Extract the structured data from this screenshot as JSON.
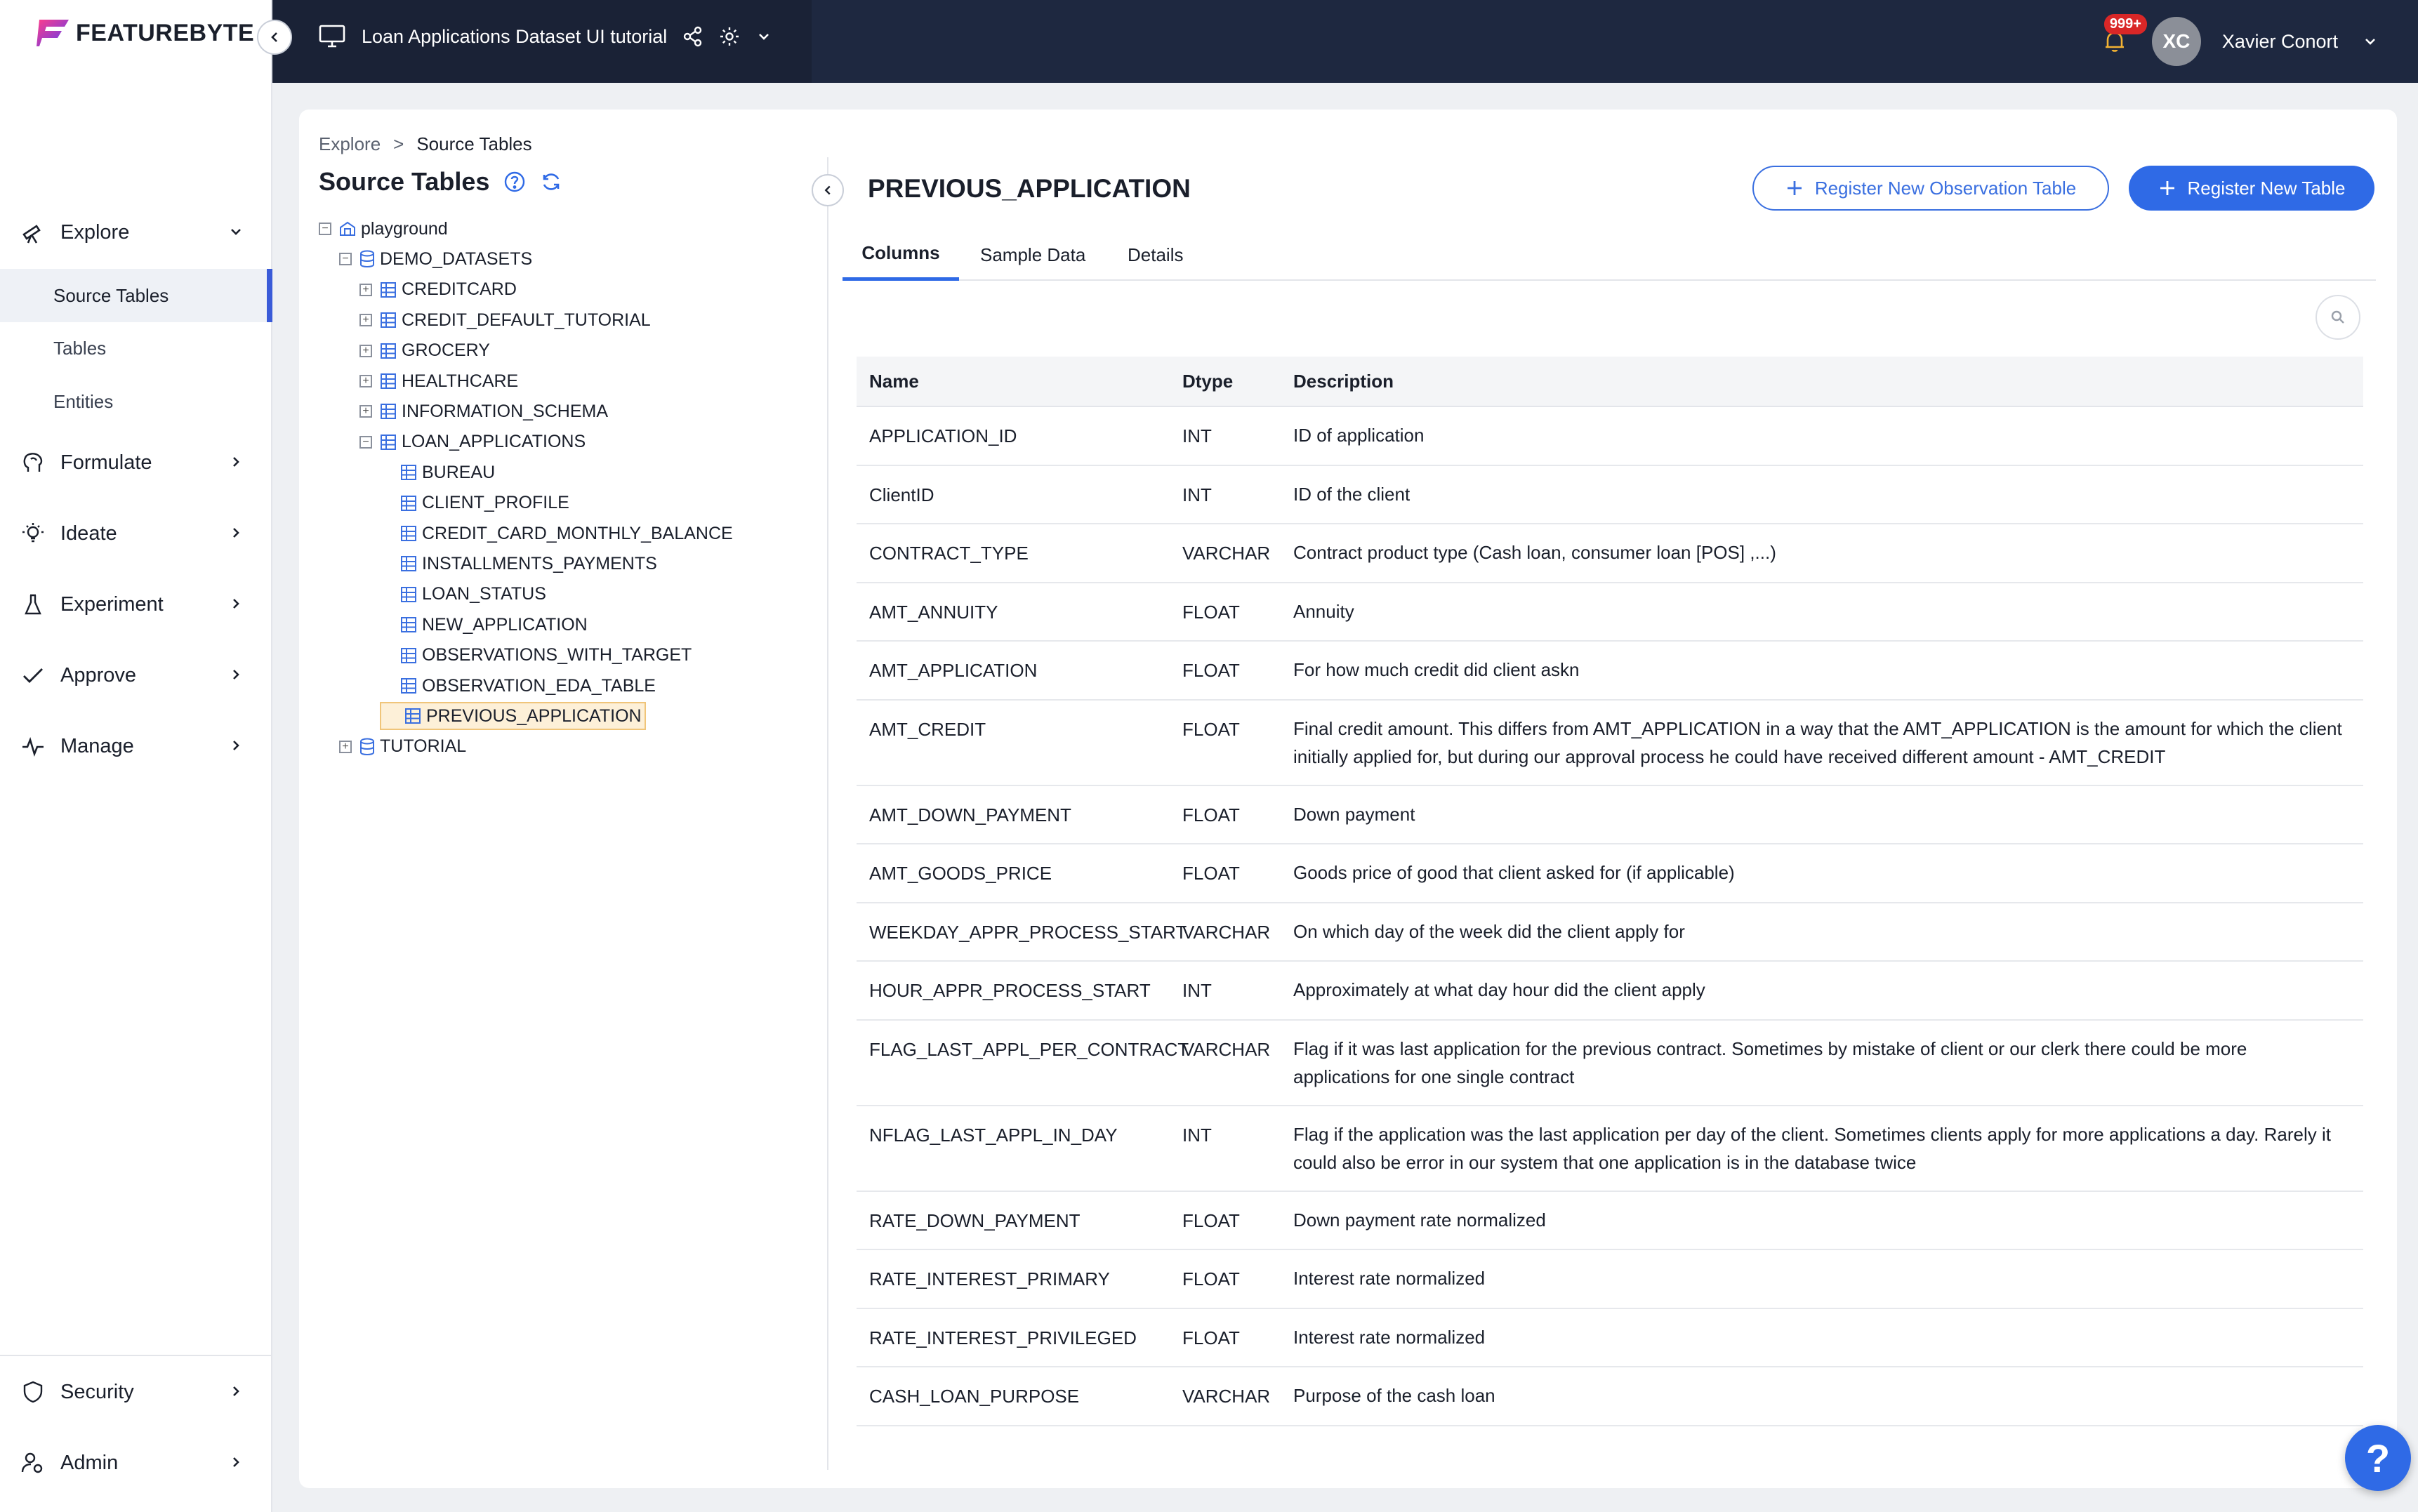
{
  "app": {
    "brand": "FEATUREBYTE",
    "accent": "#2f6ae6"
  },
  "sidebar": {
    "items": [
      {
        "label": "Explore",
        "icon": "telescope-icon"
      },
      {
        "label": "Formulate",
        "icon": "brain-icon"
      },
      {
        "label": "Ideate",
        "icon": "lightbulb-icon"
      },
      {
        "label": "Experiment",
        "icon": "flask-icon"
      },
      {
        "label": "Approve",
        "icon": "check-icon"
      },
      {
        "label": "Manage",
        "icon": "pulse-icon"
      }
    ],
    "explore_sub": [
      "Source Tables",
      "Tables",
      "Entities"
    ],
    "bottom": [
      {
        "label": "Security",
        "icon": "shield-icon"
      },
      {
        "label": "Admin",
        "icon": "user-gear-icon"
      }
    ]
  },
  "topbar": {
    "workspace": "Loan Applications Dataset UI tutorial",
    "notifications": "999+",
    "avatar_initials": "XC",
    "user_name": "Xavier Conort"
  },
  "breadcrumb": {
    "root": "Explore",
    "sep": ">",
    "current": "Source Tables"
  },
  "source_tables_title": "Source Tables",
  "tree": [
    {
      "label": "playground",
      "level": 0,
      "type": "catalog",
      "toggle": "−"
    },
    {
      "label": "DEMO_DATASETS",
      "level": 1,
      "type": "schema",
      "toggle": "−"
    },
    {
      "label": "CREDITCARD",
      "level": 2,
      "type": "schema-table",
      "toggle": "+"
    },
    {
      "label": "CREDIT_DEFAULT_TUTORIAL",
      "level": 2,
      "type": "schema-table",
      "toggle": "+"
    },
    {
      "label": "GROCERY",
      "level": 2,
      "type": "schema-table",
      "toggle": "+"
    },
    {
      "label": "HEALTHCARE",
      "level": 2,
      "type": "schema-table",
      "toggle": "+"
    },
    {
      "label": "INFORMATION_SCHEMA",
      "level": 2,
      "type": "schema-table",
      "toggle": "+"
    },
    {
      "label": "LOAN_APPLICATIONS",
      "level": 2,
      "type": "schema-table",
      "toggle": "−"
    },
    {
      "label": "BUREAU",
      "level": 3,
      "type": "table"
    },
    {
      "label": "CLIENT_PROFILE",
      "level": 3,
      "type": "table"
    },
    {
      "label": "CREDIT_CARD_MONTHLY_BALANCE",
      "level": 3,
      "type": "table"
    },
    {
      "label": "INSTALLMENTS_PAYMENTS",
      "level": 3,
      "type": "table"
    },
    {
      "label": "LOAN_STATUS",
      "level": 3,
      "type": "table"
    },
    {
      "label": "NEW_APPLICATION",
      "level": 3,
      "type": "table"
    },
    {
      "label": "OBSERVATIONS_WITH_TARGET",
      "level": 3,
      "type": "table"
    },
    {
      "label": "OBSERVATION_EDA_TABLE",
      "level": 3,
      "type": "table"
    },
    {
      "label": "PREVIOUS_APPLICATION",
      "level": 3,
      "type": "table",
      "selected": true
    },
    {
      "label": "TUTORIAL",
      "level": 1,
      "type": "schema",
      "toggle": "+"
    }
  ],
  "main": {
    "title": "PREVIOUS_APPLICATION",
    "btn_obs": "Register New Observation Table",
    "btn_table": "Register New Table",
    "tabs": [
      "Columns",
      "Sample Data",
      "Details"
    ],
    "columns": {
      "name": "Name",
      "dtype": "Dtype",
      "description": "Description"
    },
    "rows": [
      {
        "name": "APPLICATION_ID",
        "dtype": "INT",
        "desc": "ID of application"
      },
      {
        "name": "ClientID",
        "dtype": "INT",
        "desc": "ID of the client"
      },
      {
        "name": "CONTRACT_TYPE",
        "dtype": "VARCHAR",
        "desc": "Contract product type (Cash loan, consumer loan [POS] ,...)"
      },
      {
        "name": "AMT_ANNUITY",
        "dtype": "FLOAT",
        "desc": "Annuity"
      },
      {
        "name": "AMT_APPLICATION",
        "dtype": "FLOAT",
        "desc": "For how much credit did client askn"
      },
      {
        "name": "AMT_CREDIT",
        "dtype": "FLOAT",
        "desc": "Final credit amount. This differs from AMT_APPLICATION in a way that the AMT_APPLICATION is the amount for which the client initially applied for, but during our approval process he could have received different amount - AMT_CREDIT"
      },
      {
        "name": "AMT_DOWN_PAYMENT",
        "dtype": "FLOAT",
        "desc": "Down payment"
      },
      {
        "name": "AMT_GOODS_PRICE",
        "dtype": "FLOAT",
        "desc": "Goods price of good that client asked for (if applicable)"
      },
      {
        "name": "WEEKDAY_APPR_PROCESS_START",
        "dtype": "VARCHAR",
        "desc": "On which day of the week did the client apply for"
      },
      {
        "name": "HOUR_APPR_PROCESS_START",
        "dtype": "INT",
        "desc": "Approximately at what day hour did the client apply"
      },
      {
        "name": "FLAG_LAST_APPL_PER_CONTRACT",
        "dtype": "VARCHAR",
        "desc": "Flag if it was last application for the previous contract. Sometimes by mistake of client or our clerk there could be more applications for one single contract"
      },
      {
        "name": "NFLAG_LAST_APPL_IN_DAY",
        "dtype": "INT",
        "desc": "Flag if the application was the last application per day of the client. Sometimes clients apply for more applications a day. Rarely it could also be error in our system that one application is in the database twice"
      },
      {
        "name": "RATE_DOWN_PAYMENT",
        "dtype": "FLOAT",
        "desc": "Down payment rate normalized"
      },
      {
        "name": "RATE_INTEREST_PRIMARY",
        "dtype": "FLOAT",
        "desc": "Interest rate normalized"
      },
      {
        "name": "RATE_INTEREST_PRIVILEGED",
        "dtype": "FLOAT",
        "desc": "Interest rate normalized"
      },
      {
        "name": "CASH_LOAN_PURPOSE",
        "dtype": "VARCHAR",
        "desc": "Purpose of the cash loan"
      }
    ]
  },
  "help_label": "?"
}
